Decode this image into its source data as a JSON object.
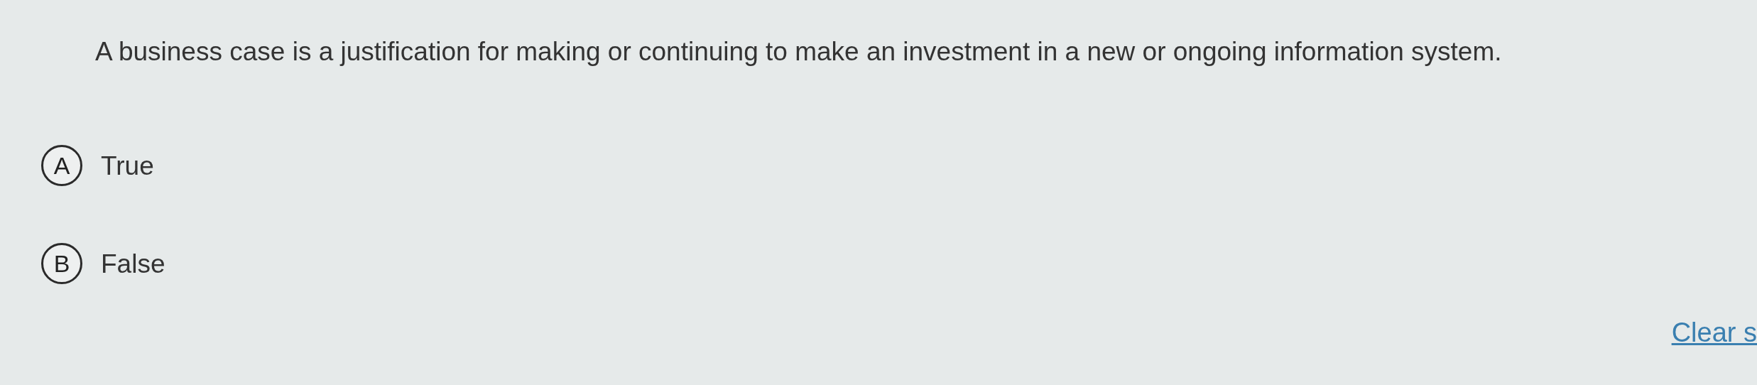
{
  "question": "A business case is a justification for making or continuing to make an investment in a new or ongoing information system.",
  "options": [
    {
      "letter": "A",
      "label": "True",
      "selected": false
    },
    {
      "letter": "B",
      "label": "False",
      "selected": false
    }
  ],
  "clear_link": "Clear s"
}
